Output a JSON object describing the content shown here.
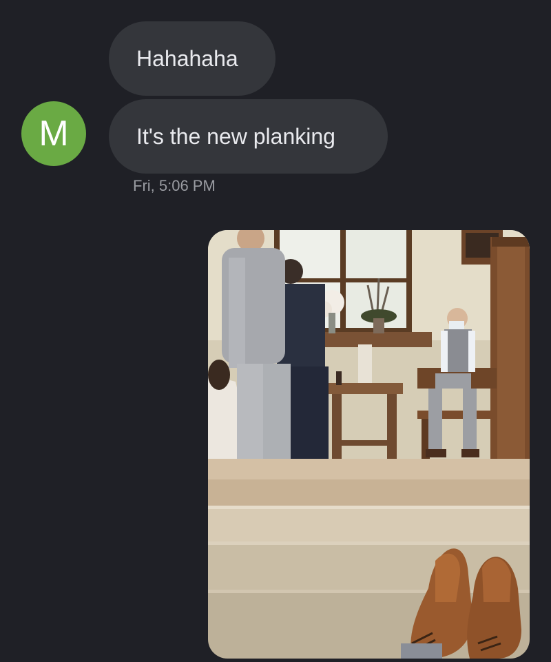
{
  "conversation": {
    "avatar_letter": "M",
    "avatar_color": "#6aaa44",
    "messages": [
      {
        "text": "Hahahaha"
      },
      {
        "text": "It's the new planking"
      }
    ],
    "timestamp": "Fri, 5:06 PM"
  },
  "colors": {
    "background": "#1f2026",
    "bubble": "#34363b",
    "bubble_text": "#e9eaee",
    "timestamp_text": "#9a9ca2"
  },
  "attachment": {
    "type": "photo",
    "subject": "wedding-ceremony-with-shoes"
  }
}
